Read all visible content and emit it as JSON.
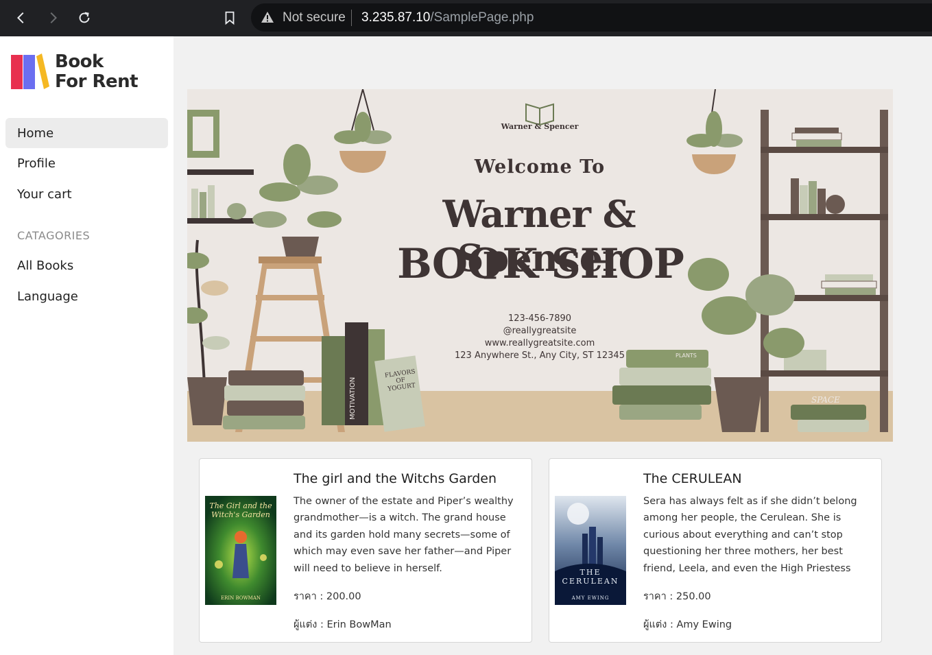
{
  "browser": {
    "security_label": "Not secure",
    "url_host": "3.235.87.10",
    "url_path": "/SamplePage.php"
  },
  "logo": {
    "line1": "Book",
    "line2": "For Rent",
    "colors": [
      "#e8304f",
      "#6b6ef0",
      "#f5b823"
    ]
  },
  "sidebar": {
    "items": [
      {
        "label": "Home",
        "active": true
      },
      {
        "label": "Profile",
        "active": false
      },
      {
        "label": "Your cart",
        "active": false
      }
    ],
    "categories_heading": "CATAGORIES",
    "category_items": [
      {
        "label": "All Books"
      },
      {
        "label": "Language"
      }
    ]
  },
  "banner": {
    "brand": "Warner & Spencer",
    "welcome": "Welcome To",
    "title_line1": "Warner & Spencer",
    "title_line2": "BOOK SHOP",
    "phone": "123-456-7890",
    "social": "@reallygreatsite",
    "website": "www.reallygreatsite.com",
    "address": "123 Anywhere St., Any City, ST 12345",
    "book_spines": [
      "MOTIVATION",
      "FLAVORS OF YOGURT",
      "SPACE",
      "PLANTS"
    ]
  },
  "books": [
    {
      "title": "The girl and the Witchs Garden",
      "description": "The owner of the estate and Piper’s wealthy grandmother—is a witch. The grand house and its garden hold many secrets—some of which may even save her father—and Piper will need to believe in herself.",
      "price_label": "ราคา : 200.00",
      "author_label": "ผู้แต่ง : Erin BowMan",
      "cover_title": "The Girl and the Witch's Garden",
      "cover_author": "ERIN BOWMAN"
    },
    {
      "title": "The CERULEAN",
      "description": "Sera has always felt as if she didn’t belong among her people, the Cerulean. She is curious about everything and can’t stop questioning her three mothers, her best friend, Leela, and even the High Priestess",
      "price_label": "ราคา : 250.00",
      "author_label": "ผู้แต่ง : Amy Ewing",
      "cover_title": "THE CERULEAN",
      "cover_author": "AMY EWING"
    }
  ]
}
